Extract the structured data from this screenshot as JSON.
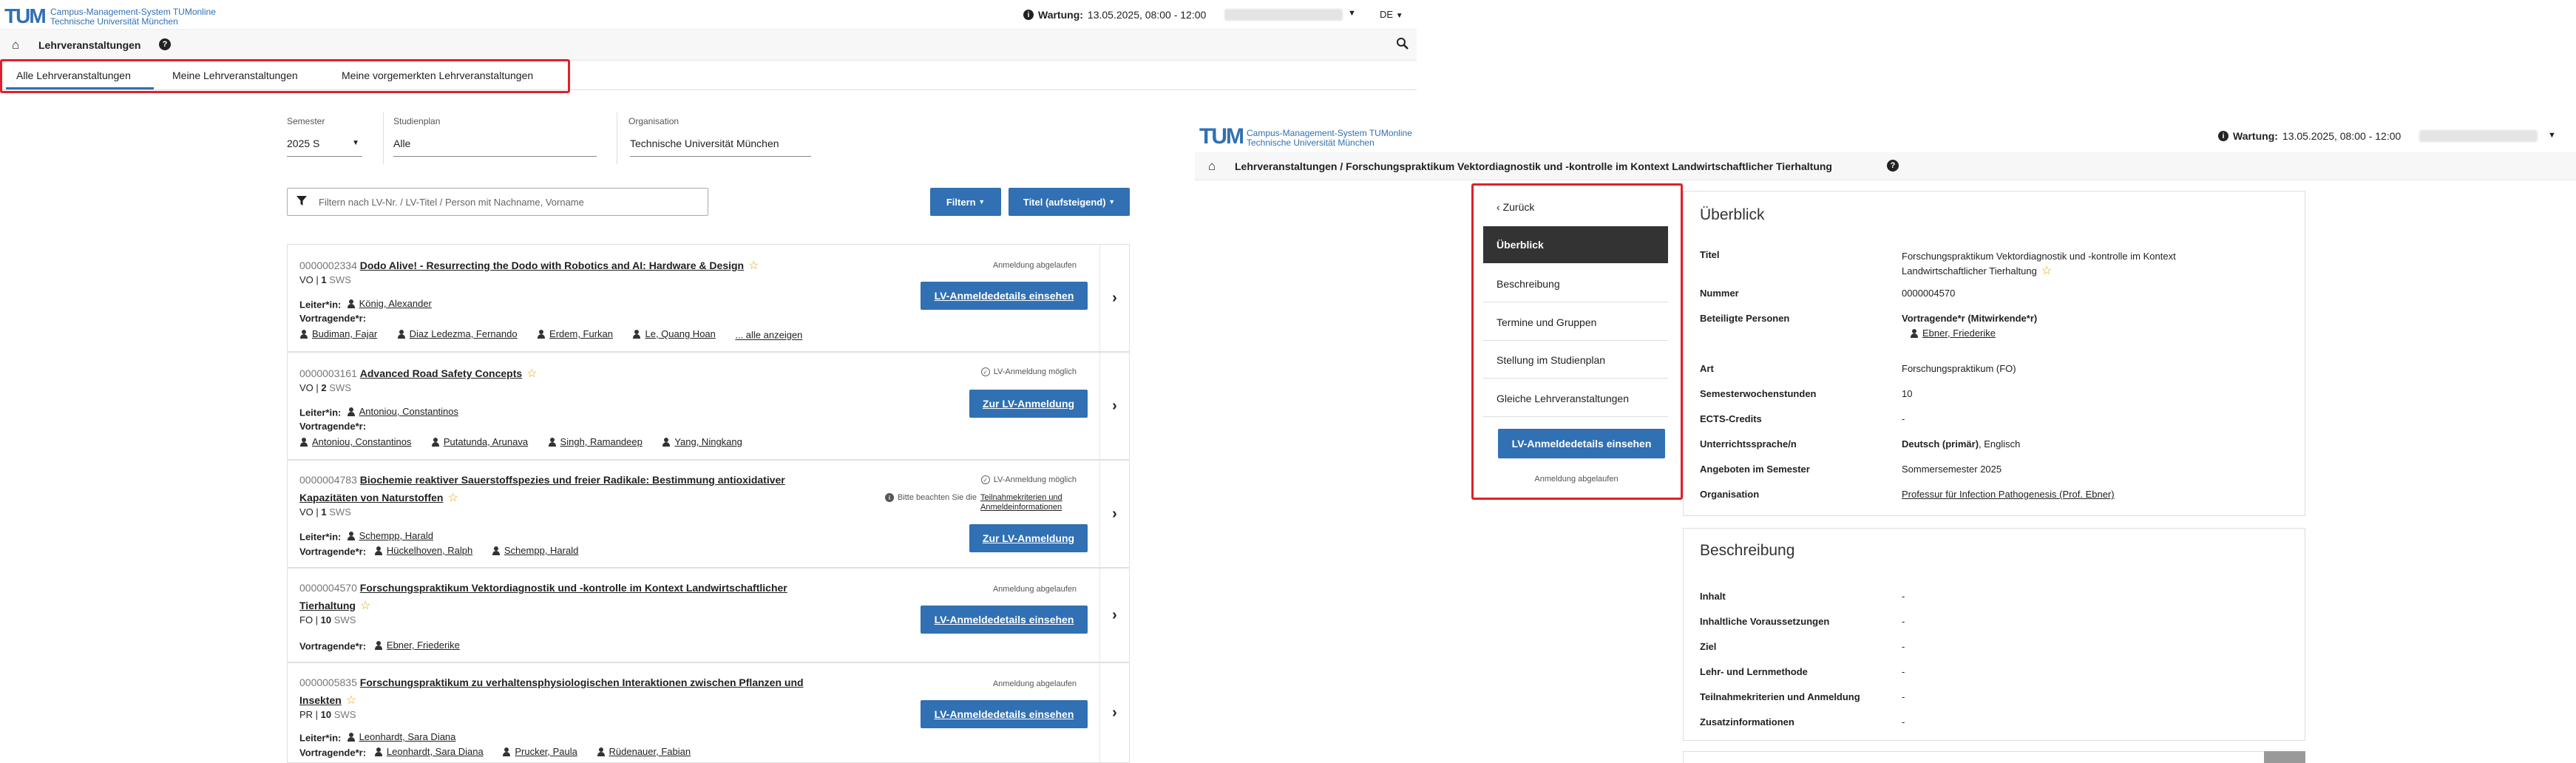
{
  "left": {
    "logo": "TUM",
    "brand_line1": "Campus-Management-System TUMonline",
    "brand_line2": "Technische Universität München",
    "maint": "Wartung:",
    "maint_date": "13.05.2025, 08:00 - 12:00",
    "lang": "DE",
    "page_title": "Lehrveranstaltungen",
    "tabs": [
      "Alle Lehrveranstaltungen",
      "Meine Lehrveranstaltungen",
      "Meine vorgemerkten Lehrveranstaltungen"
    ],
    "filters": {
      "semester_label": "Semester",
      "semester_value": "2025 S",
      "plan_label": "Studienplan",
      "plan_value": "Alle",
      "org_label": "Organisation",
      "org_value": "Technische Universität München",
      "search_placeholder": "Filtern nach LV-Nr. / LV-Titel / Person mit Nachname, Vorname",
      "filter_btn": "Filtern",
      "sort_btn": "Titel (aufsteigend)"
    },
    "courses": [
      {
        "nr": "0000002334",
        "title": "Dodo Alive! - Resurrecting the Dodo with Robotics and AI: Hardware & Design",
        "title2": "",
        "type": "VO",
        "sws": "1",
        "unit": "SWS",
        "leiter_label": "Leiter*in:",
        "leiter": [
          "König, Alexander"
        ],
        "vortr_label": "Vortragende*r:",
        "vortr": [
          "Budiman, Fajar",
          "Diaz Ledezma, Fernando",
          "Erdem, Furkan",
          "Le, Quang Hoan"
        ],
        "more": "... alle anzeigen",
        "status": "Anmeldung abgelaufen",
        "status_icon": "",
        "note": "",
        "button": "LV-Anmeldedetails einsehen"
      },
      {
        "nr": "0000003161",
        "title": "Advanced Road Safety Concepts",
        "title2": "",
        "type": "VO",
        "sws": "2",
        "unit": "SWS",
        "leiter_label": "Leiter*in:",
        "leiter": [
          "Antoniou, Constantinos"
        ],
        "vortr_label": "Vortragende*r:",
        "vortr": [
          "Antoniou, Constantinos",
          "Putatunda, Arunava",
          "Singh, Ramandeep",
          "Yang, Ningkang"
        ],
        "more": "",
        "status": "LV-Anmeldung möglich",
        "status_icon": "check",
        "note": "",
        "button": "Zur LV-Anmeldung"
      },
      {
        "nr": "0000004783",
        "title": "Biochemie reaktiver Sauerstoffspezies und freier Radikale: Bestimmung antioxidativer",
        "title2": "Kapazitäten von Naturstoffen",
        "type": "VO",
        "sws": "1",
        "unit": "SWS",
        "leiter_label": "Leiter*in:",
        "leiter": [
          "Schempp, Harald"
        ],
        "vortr_label": "Vortragende*r:",
        "vortr": [
          "Hückelhoven, Ralph",
          "Schempp, Harald"
        ],
        "more": "",
        "status": "LV-Anmeldung möglich",
        "status_icon": "check",
        "note": "Bitte beachten Sie die",
        "note_link": "Teilnahmekriterien und Anmeldeinformationen",
        "button": "Zur LV-Anmeldung"
      },
      {
        "nr": "0000004570",
        "title": "Forschungspraktikum Vektordiagnostik und -kontrolle im Kontext Landwirtschaftlicher",
        "title2": "Tierhaltung",
        "type": "FO",
        "sws": "10",
        "unit": "SWS",
        "leiter_label": "",
        "leiter": [],
        "vortr_label": "Vortragende*r:",
        "vortr": [
          "Ebner, Friederike"
        ],
        "more": "",
        "status": "Anmeldung abgelaufen",
        "status_icon": "",
        "note": "",
        "button": "LV-Anmeldedetails einsehen"
      },
      {
        "nr": "0000005835",
        "title": "Forschungspraktikum zu verhaltensphysiologischen Interaktionen zwischen Pflanzen und",
        "title2": "Insekten",
        "type": "PR",
        "sws": "10",
        "unit": "SWS",
        "leiter_label": "Leiter*in:",
        "leiter": [
          "Leonhardt, Sara Diana"
        ],
        "vortr_label": "Vortragende*r:",
        "vortr": [
          "Leonhardt, Sara Diana",
          "Prucker, Paula",
          "Rüdenauer, Fabian"
        ],
        "more": "",
        "status": "Anmeldung abgelaufen",
        "status_icon": "",
        "note": "",
        "button": "LV-Anmeldedetails einsehen"
      }
    ]
  },
  "right": {
    "logo": "TUM",
    "brand_line1": "Campus-Management-System TUMonline",
    "brand_line2": "Technische Universität München",
    "maint": "Wartung:",
    "maint_date": "13.05.2025, 08:00 - 12:00",
    "breadcrumb": "Lehrveranstaltungen / Forschungspraktikum Vektordiagnostik und -kontrolle im Kontext Landwirtschaftlicher Tierhaltung",
    "back": "Zurück",
    "nav": [
      "Überblick",
      "Beschreibung",
      "Termine und Gruppen",
      "Stellung im Studienplan",
      "Gleiche Lehrveranstaltungen"
    ],
    "nav_button": "LV-Anmeldedetails einsehen",
    "nav_status": "Anmeldung abgelaufen",
    "overview_title": "Überblick",
    "ov": {
      "titel_l": "Titel",
      "titel_v1": "Forschungspraktikum Vektordiagnostik und -kontrolle im Kontext",
      "titel_v2": "Landwirtschaftlicher Tierhaltung",
      "nr_l": "Nummer",
      "nr_v": "0000004570",
      "pers_l": "Beteiligte Personen",
      "pers_v": "Vortragende*r (Mitwirkende*r)",
      "pers_name": "Ebner, Friederike",
      "art_l": "Art",
      "art_v": "Forschungspraktikum (FO)",
      "sws_l": "Semesterwochenstunden",
      "sws_v": "10",
      "ects_l": "ECTS-Credits",
      "ects_v": "-",
      "lang_l": "Unterrichtssprache/n",
      "lang_v1": "Deutsch (primär)",
      "lang_v2": ", Englisch",
      "sem_l": "Angeboten im Semester",
      "sem_v": "Sommersemester 2025",
      "org_l": "Organisation",
      "org_v": "Professur für Infection Pathogenesis (Prof. Ebner)"
    },
    "desc_title": "Beschreibung",
    "desc": [
      {
        "l": "Inhalt",
        "v": "-"
      },
      {
        "l": "Inhaltliche Voraussetzungen",
        "v": "-"
      },
      {
        "l": "Ziel",
        "v": "-"
      },
      {
        "l": "Lehr- und Lernmethode",
        "v": "-"
      },
      {
        "l": "Teilnahmekriterien und Anmeldung",
        "v": "-"
      },
      {
        "l": "Zusatzinformationen",
        "v": "-"
      }
    ]
  },
  "colors": {
    "accent": "#3070b3",
    "highlight": "#e0202a",
    "navActive": "#333333"
  }
}
